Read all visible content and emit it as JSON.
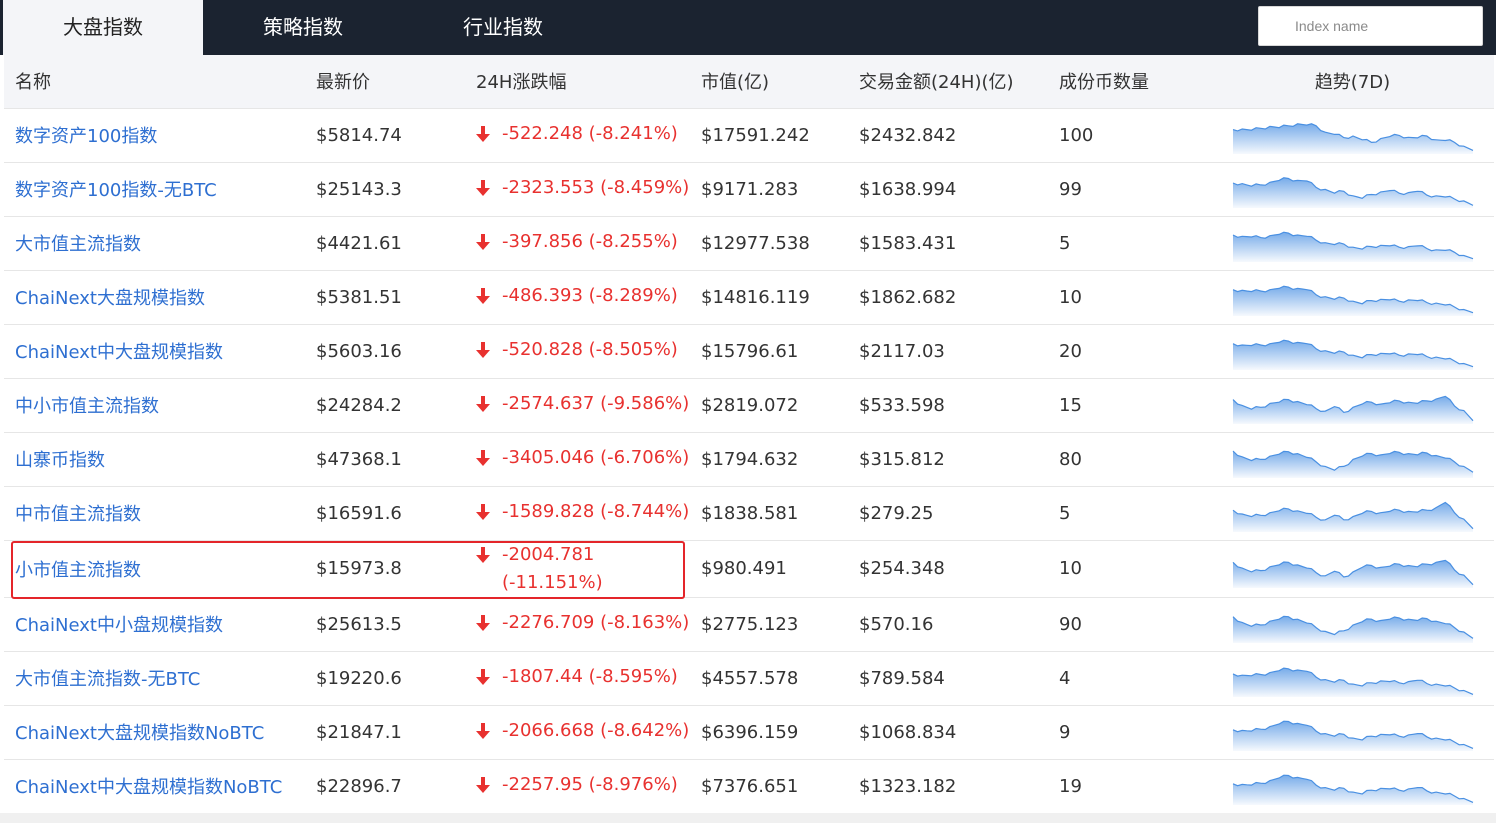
{
  "tabs": [
    {
      "label": "大盘指数",
      "active": true
    },
    {
      "label": "策略指数",
      "active": false
    },
    {
      "label": "行业指数",
      "active": false
    }
  ],
  "search": {
    "placeholder": "Index name"
  },
  "columns": [
    "名称",
    "最新价",
    "24H涨跌幅",
    "市值(亿)",
    "交易金额(24H)(亿)",
    "成份币数量",
    "趋势(7D)"
  ],
  "colors": {
    "link": "#2e6fd1",
    "down": "#e8312f",
    "sparkline": "#4a90e2",
    "header_bg": "#1b2330"
  },
  "rows": [
    {
      "name": "数字资产100指数",
      "price": "$5814.74",
      "change": "-522.248 (-8.241%)",
      "mcap": "$17591.242",
      "volume": "$2432.842",
      "count": "100",
      "trend": [
        0.7,
        0.72,
        0.68,
        0.74,
        0.8,
        0.76,
        0.82,
        0.88,
        0.84,
        0.82,
        0.62,
        0.55,
        0.45,
        0.5,
        0.38,
        0.3,
        0.42,
        0.48,
        0.52,
        0.46,
        0.44,
        0.5,
        0.38,
        0.36,
        0.3,
        0.18,
        0.05
      ]
    },
    {
      "name": "数字资产100指数-无BTC",
      "price": "$25143.3",
      "change": "-2323.553 (-8.459%)",
      "mcap": "$9171.283",
      "volume": "$1638.994",
      "count": "99",
      "trend": [
        0.72,
        0.7,
        0.62,
        0.66,
        0.74,
        0.8,
        0.86,
        0.8,
        0.78,
        0.58,
        0.52,
        0.4,
        0.46,
        0.32,
        0.24,
        0.36,
        0.44,
        0.48,
        0.4,
        0.42,
        0.46,
        0.34,
        0.32,
        0.28,
        0.22,
        0.16,
        0.02
      ]
    },
    {
      "name": "大市值主流指数",
      "price": "$4421.61",
      "change": "-397.856 (-8.255%)",
      "mcap": "$12977.538",
      "volume": "$1583.431",
      "count": "5",
      "trend": [
        0.78,
        0.74,
        0.72,
        0.7,
        0.76,
        0.8,
        0.84,
        0.78,
        0.74,
        0.62,
        0.54,
        0.48,
        0.5,
        0.4,
        0.34,
        0.42,
        0.46,
        0.44,
        0.4,
        0.42,
        0.44,
        0.36,
        0.32,
        0.3,
        0.24,
        0.14,
        0.04
      ]
    },
    {
      "name": "ChaiNext大盘规模指数",
      "price": "$5381.51",
      "change": "-486.393 (-8.289%)",
      "mcap": "$14816.119",
      "volume": "$1862.682",
      "count": "10",
      "trend": [
        0.76,
        0.74,
        0.7,
        0.72,
        0.76,
        0.8,
        0.84,
        0.8,
        0.76,
        0.6,
        0.54,
        0.46,
        0.5,
        0.4,
        0.32,
        0.42,
        0.46,
        0.44,
        0.4,
        0.44,
        0.42,
        0.36,
        0.34,
        0.28,
        0.22,
        0.14,
        0.04
      ]
    },
    {
      "name": "ChaiNext中大盘规模指数",
      "price": "$5603.16",
      "change": "-520.828 (-8.505%)",
      "mcap": "$15796.61",
      "volume": "$2117.03",
      "count": "20",
      "trend": [
        0.76,
        0.72,
        0.7,
        0.72,
        0.76,
        0.8,
        0.84,
        0.8,
        0.76,
        0.6,
        0.54,
        0.46,
        0.5,
        0.4,
        0.32,
        0.42,
        0.46,
        0.44,
        0.4,
        0.44,
        0.42,
        0.36,
        0.34,
        0.28,
        0.22,
        0.14,
        0.04
      ]
    },
    {
      "name": "中小市值主流指数",
      "price": "$24284.2",
      "change": "-2574.637 (-9.586%)",
      "mcap": "$2819.072",
      "volume": "$533.598",
      "count": "15",
      "trend": [
        0.7,
        0.52,
        0.4,
        0.46,
        0.58,
        0.62,
        0.7,
        0.64,
        0.54,
        0.42,
        0.34,
        0.48,
        0.3,
        0.46,
        0.56,
        0.62,
        0.56,
        0.6,
        0.66,
        0.62,
        0.58,
        0.66,
        0.72,
        0.8,
        0.5,
        0.36,
        0.04
      ]
    },
    {
      "name": "山寨币指数",
      "price": "$47368.1",
      "change": "-3405.046 (-6.706%)",
      "mcap": "$1794.632",
      "volume": "$315.812",
      "count": "80",
      "trend": [
        0.78,
        0.6,
        0.48,
        0.52,
        0.62,
        0.68,
        0.76,
        0.7,
        0.58,
        0.44,
        0.3,
        0.18,
        0.3,
        0.52,
        0.62,
        0.7,
        0.66,
        0.7,
        0.74,
        0.7,
        0.66,
        0.72,
        0.64,
        0.56,
        0.44,
        0.3,
        0.12
      ]
    },
    {
      "name": "中市值主流指数",
      "price": "$16591.6",
      "change": "-1589.828 (-8.744%)",
      "mcap": "$1838.581",
      "volume": "$279.25",
      "count": "5",
      "trend": [
        0.62,
        0.5,
        0.42,
        0.46,
        0.54,
        0.6,
        0.66,
        0.6,
        0.52,
        0.4,
        0.32,
        0.46,
        0.32,
        0.42,
        0.52,
        0.58,
        0.54,
        0.58,
        0.62,
        0.58,
        0.56,
        0.62,
        0.7,
        0.86,
        0.54,
        0.34,
        0.04
      ]
    },
    {
      "name": "小市值主流指数",
      "price": "$15973.8",
      "change": "-2004.781 (-11.151%)",
      "mcap": "$980.491",
      "volume": "$254.348",
      "count": "10",
      "wrap": true,
      "trend": [
        0.74,
        0.56,
        0.44,
        0.48,
        0.6,
        0.66,
        0.74,
        0.66,
        0.56,
        0.42,
        0.32,
        0.46,
        0.28,
        0.44,
        0.58,
        0.64,
        0.58,
        0.62,
        0.68,
        0.64,
        0.6,
        0.68,
        0.74,
        0.8,
        0.5,
        0.34,
        0.04
      ]
    },
    {
      "name": "ChaiNext中小盘规模指数",
      "price": "$25613.5",
      "change": "-2276.709 (-8.163%)",
      "mcap": "$2775.123",
      "volume": "$570.16",
      "count": "90",
      "trend": [
        0.76,
        0.58,
        0.46,
        0.5,
        0.62,
        0.68,
        0.76,
        0.68,
        0.56,
        0.42,
        0.3,
        0.2,
        0.32,
        0.5,
        0.6,
        0.68,
        0.64,
        0.68,
        0.72,
        0.68,
        0.64,
        0.7,
        0.62,
        0.54,
        0.42,
        0.28,
        0.08
      ]
    },
    {
      "name": "大市值主流指数-无BTC",
      "price": "$19220.6",
      "change": "-1807.44 (-8.595%)",
      "mcap": "$4557.578",
      "volume": "$789.584",
      "count": "4",
      "trend": [
        0.66,
        0.62,
        0.6,
        0.64,
        0.7,
        0.76,
        0.82,
        0.78,
        0.74,
        0.56,
        0.48,
        0.4,
        0.46,
        0.34,
        0.28,
        0.38,
        0.44,
        0.42,
        0.38,
        0.42,
        0.46,
        0.36,
        0.34,
        0.28,
        0.22,
        0.14,
        0.02
      ]
    },
    {
      "name": "ChaiNext大盘规模指数NoBTC",
      "price": "$21847.1",
      "change": "-2066.668 (-8.642%)",
      "mcap": "$6396.159",
      "volume": "$1068.834",
      "count": "9",
      "trend": [
        0.6,
        0.58,
        0.56,
        0.62,
        0.7,
        0.78,
        0.86,
        0.8,
        0.74,
        0.56,
        0.48,
        0.4,
        0.46,
        0.34,
        0.28,
        0.4,
        0.46,
        0.44,
        0.4,
        0.44,
        0.48,
        0.38,
        0.34,
        0.28,
        0.22,
        0.14,
        0.02
      ]
    },
    {
      "name": "ChaiNext中大盘规模指数NoBTC",
      "price": "$22896.7",
      "change": "-2257.95 (-8.976%)",
      "mcap": "$7376.651",
      "volume": "$1323.182",
      "count": "19",
      "trend": [
        0.6,
        0.58,
        0.56,
        0.62,
        0.7,
        0.78,
        0.86,
        0.8,
        0.74,
        0.56,
        0.48,
        0.4,
        0.46,
        0.34,
        0.28,
        0.4,
        0.46,
        0.44,
        0.4,
        0.44,
        0.48,
        0.38,
        0.34,
        0.28,
        0.22,
        0.14,
        0.02
      ]
    }
  ]
}
